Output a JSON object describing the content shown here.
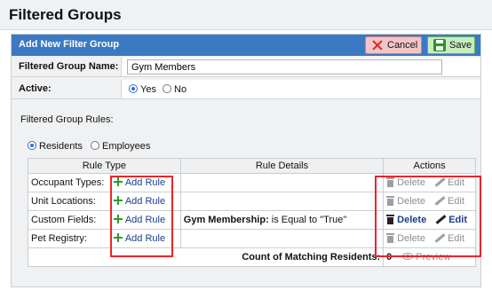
{
  "page": {
    "title": "Filtered Groups"
  },
  "panel": {
    "title": "Add New Filter Group",
    "cancel_label": "Cancel",
    "save_label": "Save"
  },
  "form": {
    "name_label": "Filtered Group Name:",
    "name_value": "Gym Members",
    "active_label": "Active:",
    "active_yes": "Yes",
    "active_no": "No",
    "active_selected": "Yes"
  },
  "rules": {
    "heading": "Filtered Group Rules:",
    "target_options": [
      "Residents",
      "Employees"
    ],
    "target_selected": "Residents",
    "columns": [
      "Rule Type",
      "Rule Details",
      "Actions"
    ],
    "add_rule_label": "Add Rule",
    "delete_label": "Delete",
    "edit_label": "Edit",
    "rows": [
      {
        "type": "Occupant Types:",
        "details_field": "",
        "details_text": "",
        "active": false
      },
      {
        "type": "Unit Locations:",
        "details_field": "",
        "details_text": "",
        "active": false
      },
      {
        "type": "Custom Fields:",
        "details_field": "Gym Membership:",
        "details_text": " is Equal to \"True\"",
        "active": true
      },
      {
        "type": "Pet Registry:",
        "details_field": "",
        "details_text": "",
        "active": false
      }
    ],
    "count_label": "Count of Matching Residents:",
    "count_value": "0",
    "preview_label": "Preview"
  },
  "colors": {
    "panel_bar": "#3b7ac3",
    "highlight": "#e8262a",
    "link": "#1a3d8f"
  }
}
